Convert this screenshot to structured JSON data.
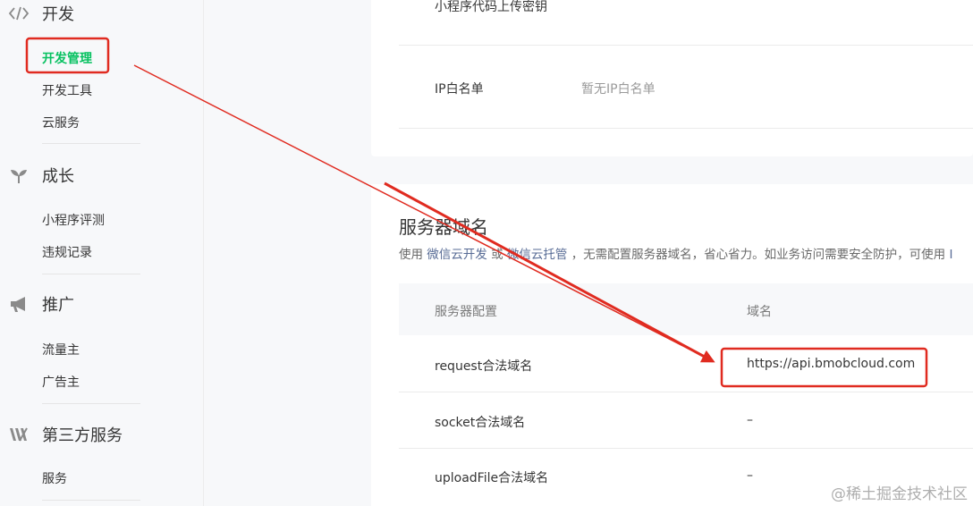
{
  "sidebar": {
    "sections": [
      {
        "title": "开发",
        "icon": "code-icon",
        "items": [
          "开发管理",
          "开发工具",
          "云服务"
        ]
      },
      {
        "title": "成长",
        "icon": "sprout-icon",
        "items": [
          "小程序评测",
          "违规记录"
        ]
      },
      {
        "title": "推广",
        "icon": "megaphone-icon",
        "items": [
          "流量主",
          "广告主"
        ]
      },
      {
        "title": "第三方服务",
        "icon": "third-party-icon",
        "items": [
          "服务"
        ]
      }
    ],
    "active_item": "开发管理"
  },
  "top_card": {
    "upload_key_label": "小程序代码上传密钥",
    "ip_whitelist_label": "IP白名单",
    "ip_whitelist_value": "暂无IP白名单"
  },
  "server_domain": {
    "title": "服务器域名",
    "desc_prefix": "使用",
    "link1": "微信云开发",
    "desc_or": "或",
    "link2": "微信云托管",
    "desc_suffix": "，无需配置服务器域名，省心省力。如业务访问需要安全防护，可使用",
    "desc_tail": "I",
    "col_config": "服务器配置",
    "col_domain": "域名",
    "rows": [
      {
        "config": "request合法域名",
        "domain": "https://api.bmobcloud.com"
      },
      {
        "config": "socket合法域名",
        "domain": "–"
      },
      {
        "config": "uploadFile合法域名",
        "domain": "–"
      }
    ]
  },
  "annotation_color": "#e02b20",
  "accent_color": "#07c160",
  "watermark": "@稀土掘金技术社区"
}
